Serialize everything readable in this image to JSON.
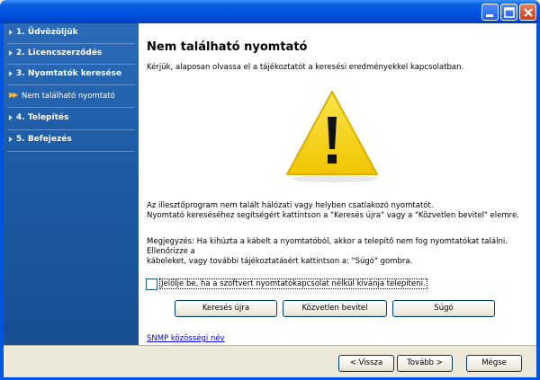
{
  "window": {
    "buttons": [
      "minimize-icon",
      "maximize-icon",
      "close-icon"
    ]
  },
  "sidebar": {
    "steps": [
      {
        "label": "1. Üdvözöljük"
      },
      {
        "label": "2. Licencszerződés"
      },
      {
        "label": "3. Nyomtatók keresése"
      },
      {
        "label": "Nem található nyomtató",
        "sub": true
      },
      {
        "label": "4. Telepítés"
      },
      {
        "label": "5. Befejezés"
      }
    ]
  },
  "main": {
    "title": "Nem található nyomtató",
    "intro": "Kérjük, alaposan olvassa el a tájékoztatót a keresési eredményekkel kapcsolatban.",
    "warning_icon": "warning-triangle-icon",
    "para1_line1": "Az illesztőprogram nem talált hálózati vagy helyben csatlakozó nyomtatót.",
    "para1_line2": "Nyomtató kereséséhez segítségért kattintson a \"Keresés újra\" vagy a \"Közvetlen bevitel\" elemre.",
    "para2_line1": "Megjegyzés: Ha kihúzta a kábelt a nyomtatóból, akkor a telepítő nem fog nyomtatókat találni. Ellenőrizze a",
    "para2_line2": "kábeleket, vagy további tájékoztatásért kattintson a: \"Súgó\" gombra.",
    "checkbox_label": "Jelölje be, ha a szoftvert nyomtatókapcsolat nélkül kívánja telepíteni.",
    "checkbox_checked": false,
    "btn_search_again": "Keresés újra",
    "btn_direct_input": "Közvetlen bevitel",
    "btn_help": "Súgó",
    "snmp_link": "SNMP közösségi név"
  },
  "footer": {
    "back": "< Vissza",
    "next": "Tovább >",
    "cancel": "Mégse"
  },
  "colors": {
    "titlebar": "#0054e3",
    "sidebar": "#1e5ca6",
    "warning_fill": "#f5d20c"
  }
}
